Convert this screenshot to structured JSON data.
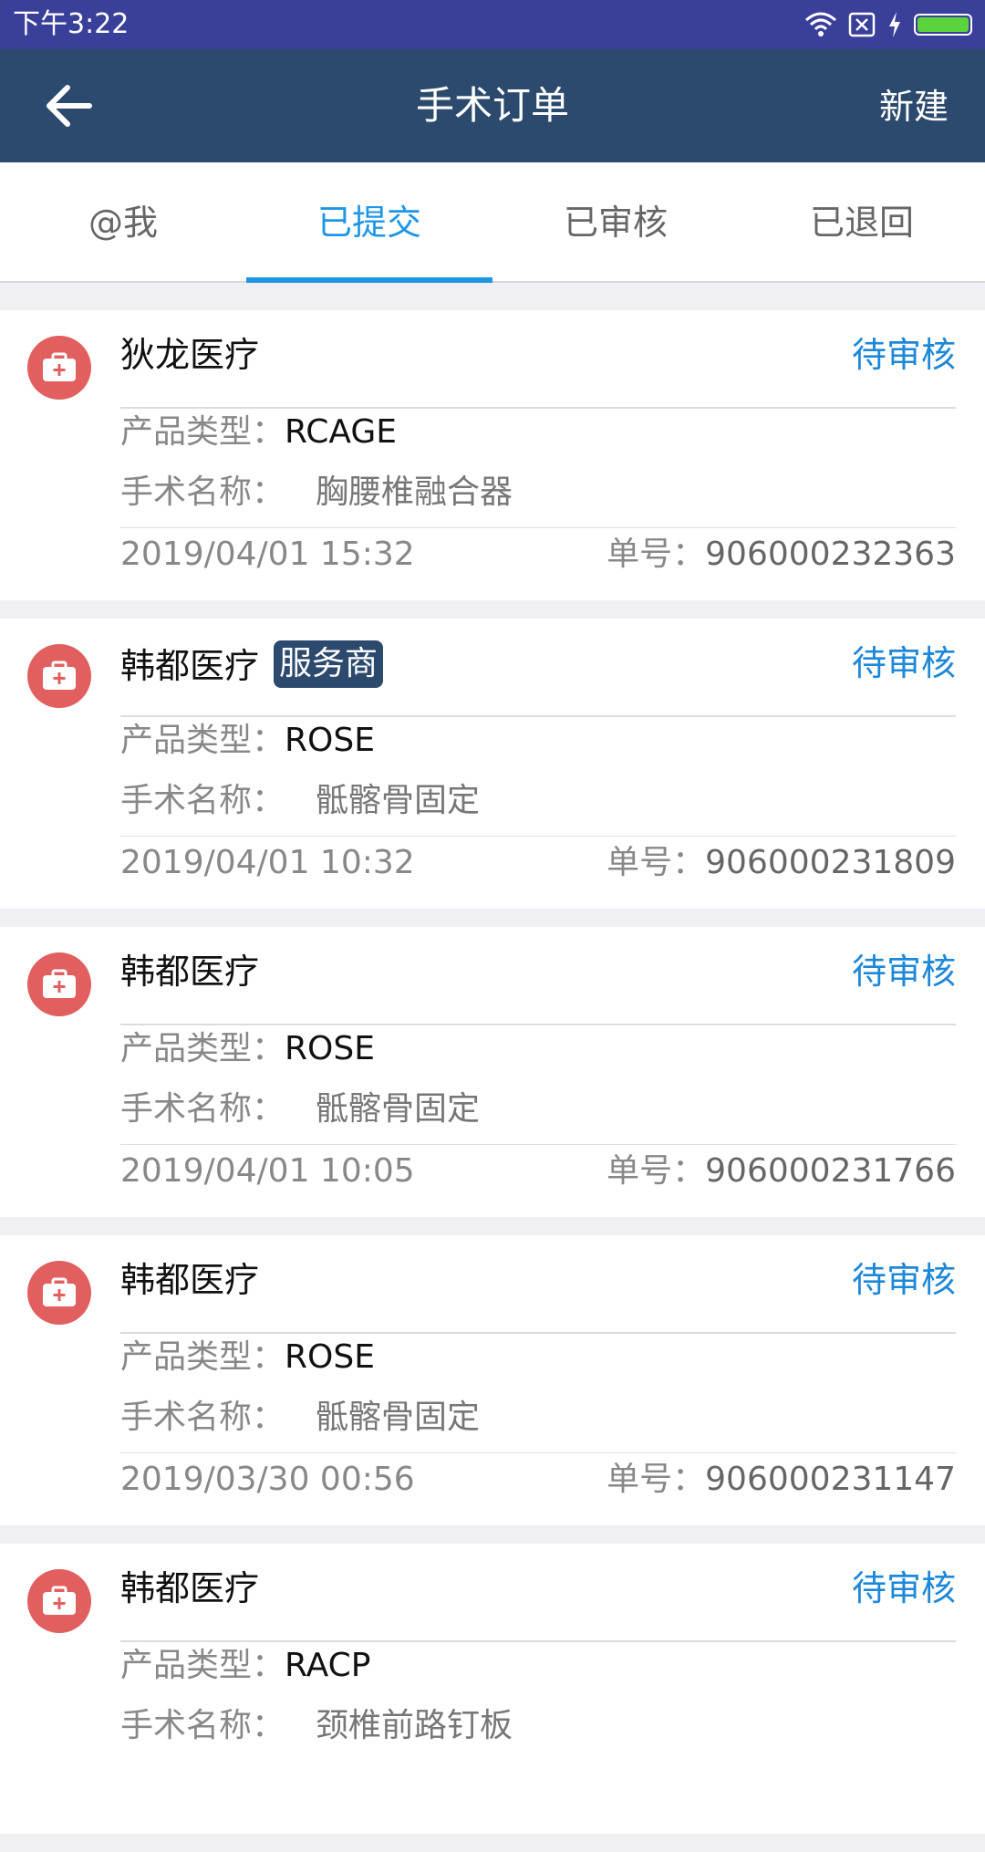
{
  "status_bar": {
    "time": "下午3:22",
    "icons": [
      "wifi-icon",
      "sim-off-icon",
      "charging-icon",
      "battery-icon"
    ]
  },
  "app_bar": {
    "title": "手术订单",
    "new_label": "新建"
  },
  "tabs": [
    {
      "label": "@我",
      "active": false
    },
    {
      "label": "已提交",
      "active": true
    },
    {
      "label": "已审核",
      "active": false
    },
    {
      "label": "已退回",
      "active": false
    }
  ],
  "labels": {
    "product_type": "产品类型：",
    "surgery_name": "手术名称：",
    "order_no": "单号："
  },
  "orders": [
    {
      "company": "狄龙医疗",
      "badge": "",
      "status": "待审核",
      "product_type": "RCAGE",
      "surgery_name": "胸腰椎融合器",
      "datetime": "2019/04/01 15:32",
      "order_no": "906000232363"
    },
    {
      "company": "韩都医疗",
      "badge": "服务商",
      "status": "待审核",
      "product_type": "ROSE",
      "surgery_name": "骶髂骨固定",
      "datetime": "2019/04/01 10:32",
      "order_no": "906000231809"
    },
    {
      "company": "韩都医疗",
      "badge": "",
      "status": "待审核",
      "product_type": "ROSE",
      "surgery_name": "骶髂骨固定",
      "datetime": "2019/04/01 10:05",
      "order_no": "906000231766"
    },
    {
      "company": "韩都医疗",
      "badge": "",
      "status": "待审核",
      "product_type": "ROSE",
      "surgery_name": "骶髂骨固定",
      "datetime": "2019/03/30 00:56",
      "order_no": "906000231147"
    },
    {
      "company": "韩都医疗",
      "badge": "",
      "status": "待审核",
      "product_type": "RACP",
      "surgery_name": "颈椎前路钉板",
      "datetime": "",
      "order_no": ""
    }
  ],
  "colors": {
    "status_bar": "#3a3f9a",
    "app_bar": "#2c4a6e",
    "accent": "#1e96e4",
    "icon_bg": "#e15f5f"
  }
}
